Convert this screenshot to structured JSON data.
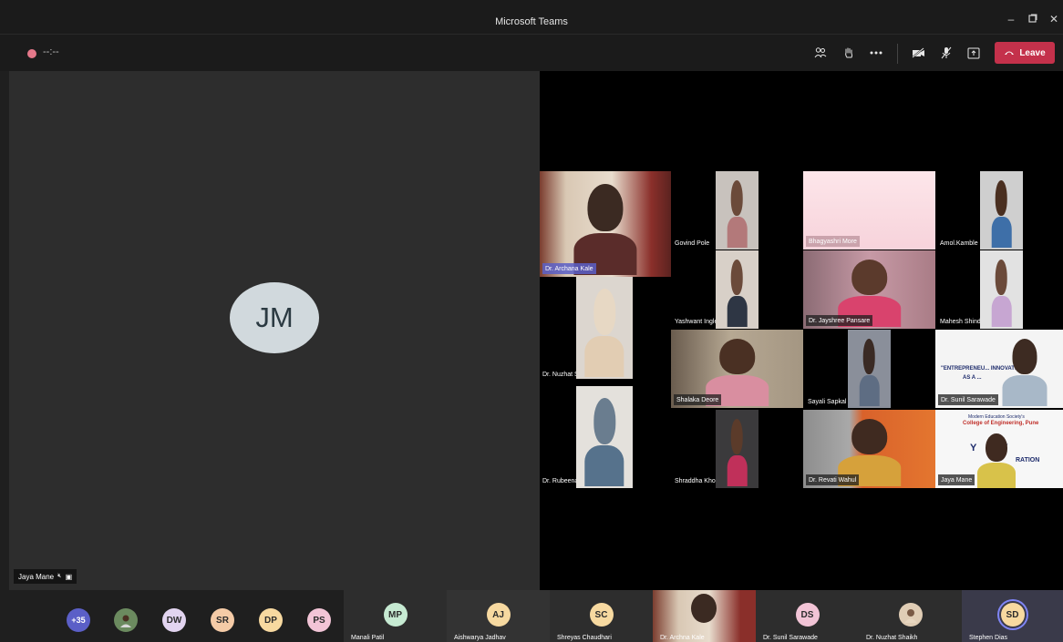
{
  "window": {
    "title": "Microsoft Teams"
  },
  "toolbar": {
    "timer": "--:--",
    "leave_label": "Leave"
  },
  "stage": {
    "initials": "JM",
    "name": "Jaya Mane"
  },
  "grid": [
    {
      "name": "Dr. Archana Kale"
    },
    {
      "name": "Govind Pole"
    },
    {
      "name": "Bhagyashri More"
    },
    {
      "name": "Amol.Kamble"
    },
    {
      "name": "Yashwant Ingle"
    },
    {
      "name": "Dr. Jayshree Pansare"
    },
    {
      "name": "Mahesh Shinde"
    },
    {
      "name": "Dr. Nuzhat Shaikh"
    },
    {
      "name": "Shalaka Deore"
    },
    {
      "name": "Sayali Sapkal"
    },
    {
      "name": "Dr. Sunil Sarawade"
    },
    {
      "name": "Dr. Rubeena A Khan"
    },
    {
      "name": "Shraddha Khonde"
    },
    {
      "name": "Dr. Revati Wahul"
    },
    {
      "name": "Jaya Mane"
    }
  ],
  "slide": {
    "line1": "\"ENTREPRENEU... INNOVATION",
    "line2": "AS A ...",
    "org": "Modern Education Society's",
    "college": "College of Engineering, Pune",
    "big1": "Y    DAY",
    "big2": "RATION"
  },
  "strip": {
    "overflow": "+35",
    "avatars": [
      "DW",
      "SR",
      "DP",
      "PS"
    ],
    "tiles": [
      {
        "initials": "MP",
        "name": "Manali Patil"
      },
      {
        "initials": "AJ",
        "name": "Aishwarya Jadhav"
      },
      {
        "initials": "SC",
        "name": "Shreyas Chaudhari"
      },
      {
        "initials": "",
        "name": "Dr. Archna Kale"
      },
      {
        "initials": "DS",
        "name": "Dr. Sunil Sarawade"
      },
      {
        "initials": "",
        "name": "Dr. Nuzhat Shaikh"
      },
      {
        "initials": "SD",
        "name": "Stephen Dias"
      }
    ]
  },
  "colors": {
    "accent": "#5b5fc7",
    "leave": "#c4314b",
    "recording": "#e5788a"
  }
}
